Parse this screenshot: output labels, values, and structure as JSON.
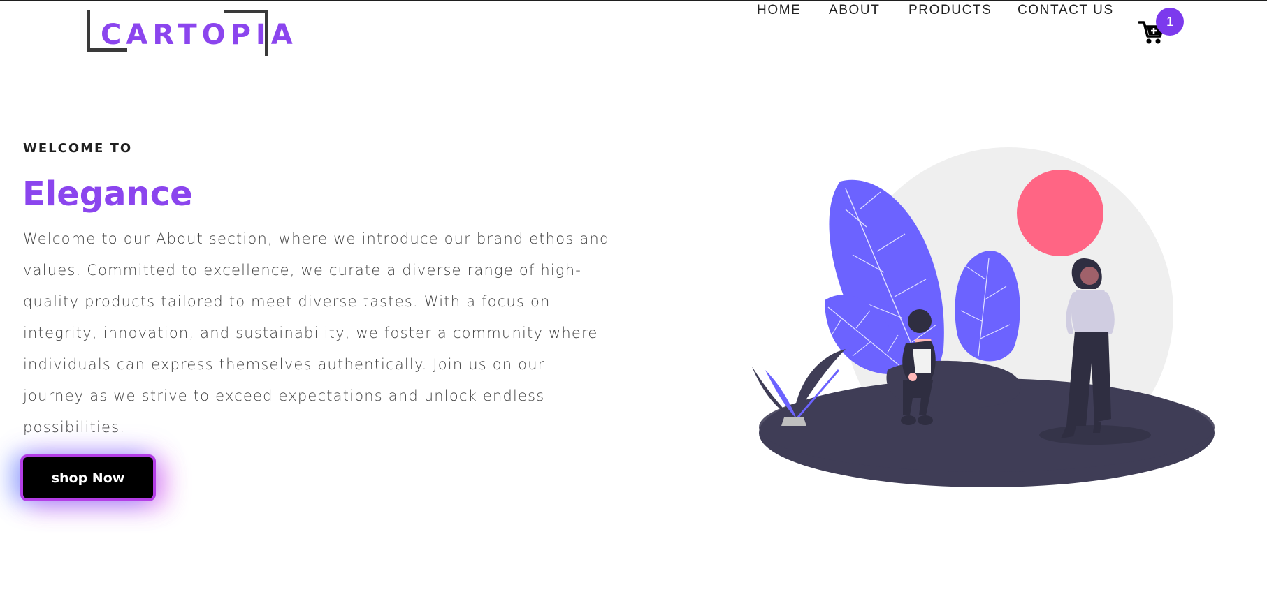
{
  "brand": {
    "logo_text": "CARTOPIA"
  },
  "nav": {
    "items": [
      {
        "label": "HOME"
      },
      {
        "label": "ABOUT"
      },
      {
        "label": "PRODUCTS"
      },
      {
        "label": "CONTACT US"
      }
    ]
  },
  "cart": {
    "count": "1",
    "icon": "cart-icon"
  },
  "hero": {
    "eyebrow": "WELCOME TO",
    "title": "Elegance",
    "paragraph": "Welcome to our About section, where we introduce our brand ethos and values. Committed to excellence, we curate a diverse range of high-quality products tailored to meet diverse tastes. With a focus on integrity, innovation, and sustainability, we foster a community where individuals can express themselves authentically. Join us on our journey as we strive to exceed expectations and unlock endless possibilities.",
    "cta_label": "shop Now"
  },
  "colors": {
    "accent": "#8b45ee",
    "badge": "#7c3aed",
    "leaf": "#6c63ff",
    "sun": "#ff6584",
    "ground": "#3f3d56"
  }
}
